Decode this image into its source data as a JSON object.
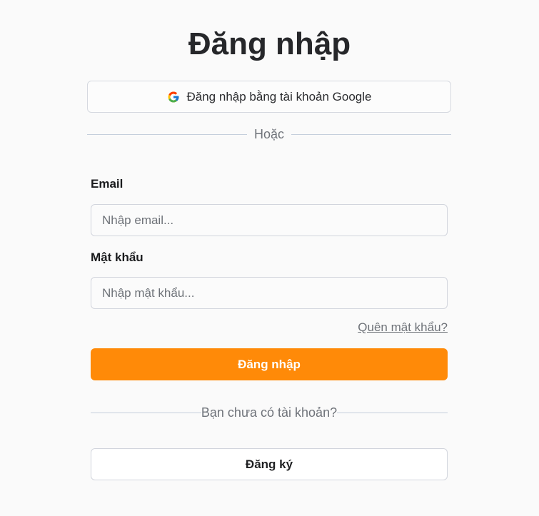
{
  "page": {
    "title": "Đăng nhập"
  },
  "google": {
    "button_label": "Đăng nhập bằng tài khoản Google",
    "icon": "google-icon"
  },
  "divider": {
    "or_text": "Hoặc",
    "no_account_text": "Bạn chưa có tài khoản?"
  },
  "form": {
    "email": {
      "label": "Email",
      "placeholder": "Nhập email...",
      "value": ""
    },
    "password": {
      "label": "Mật khẩu",
      "placeholder": "Nhập mật khẩu...",
      "value": ""
    },
    "forgot_password": "Quên mật khẩu?",
    "submit_label": "Đăng nhập"
  },
  "register": {
    "button_label": "Đăng ký"
  },
  "colors": {
    "accent": "#ff8a08",
    "background": "#fafafa",
    "divider": "#c5cfdc",
    "muted_text": "#6f737a"
  }
}
